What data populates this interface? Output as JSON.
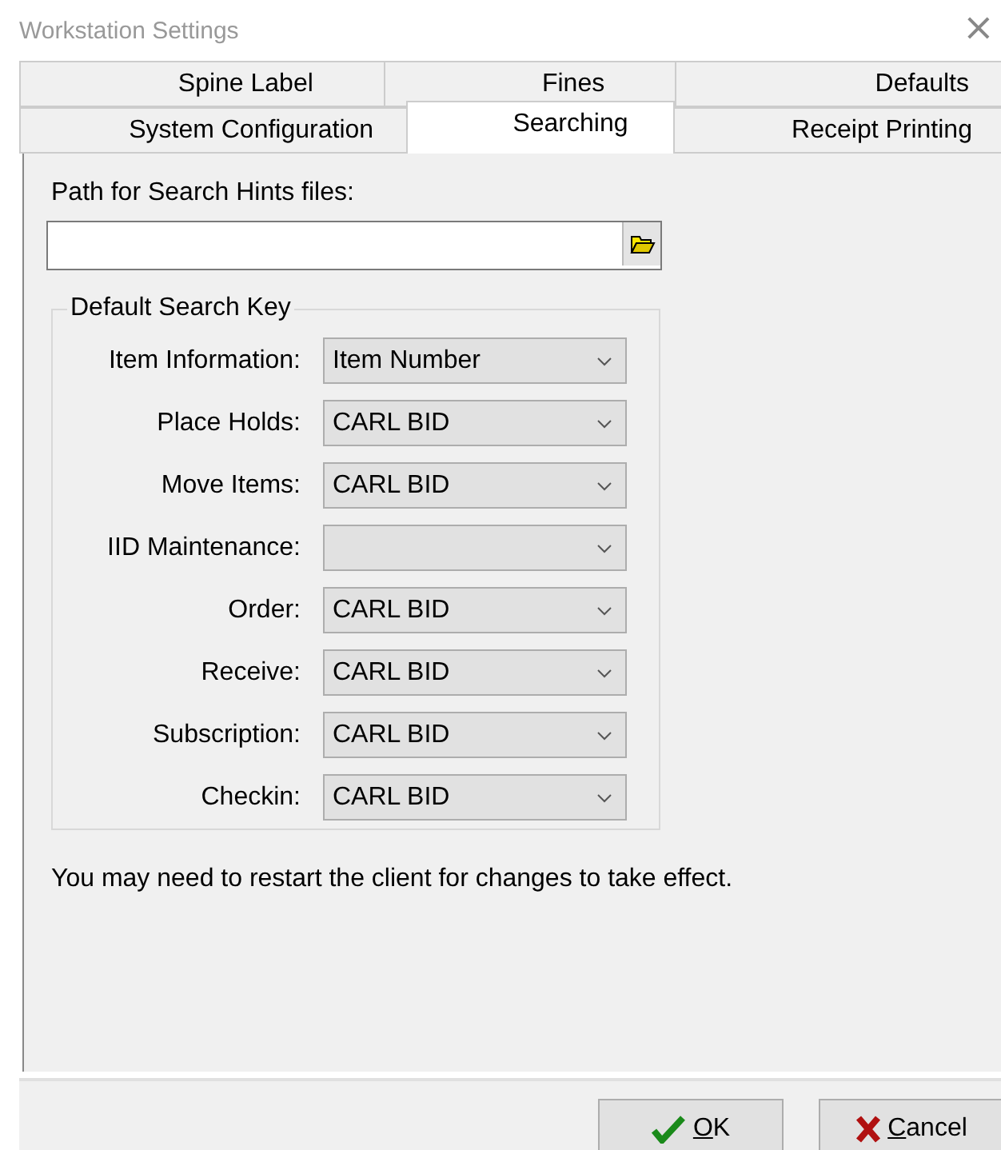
{
  "window": {
    "title": "Workstation Settings",
    "close": "×"
  },
  "tab_rows": [
    {
      "tabs": [
        {
          "label": "Spine Label",
          "selected": false
        },
        {
          "label": "Fines",
          "selected": false
        },
        {
          "label": "Defaults",
          "selected": false
        }
      ]
    },
    {
      "tabs": [
        {
          "label": "System Configuration",
          "selected": false
        },
        {
          "label": "Searching",
          "selected": true
        },
        {
          "label": "Receipt Printing",
          "selected": false
        }
      ]
    }
  ],
  "path_label": "Path for Search Hints files:",
  "group": {
    "title": "Default Search Key",
    "rows": [
      {
        "label": "Item Information:",
        "value": "Item Number"
      },
      {
        "label": "Place Holds:",
        "value": "CARL BID"
      },
      {
        "label": "Move Items:",
        "value": "CARL BID"
      },
      {
        "label": "IID Maintenance:"
      },
      {
        "label": "Order:",
        "value": "CARL BID"
      },
      {
        "label": "Receive:",
        "value": "CARL BID"
      },
      {
        "label": "Subscription:",
        "value": "CARL BID"
      },
      {
        "label": "Checkin:",
        "value": "CARL BID"
      }
    ]
  },
  "note": "You may need to restart the client for changes to take effect.",
  "buttons": [
    {
      "kind": "ok",
      "label": "OK"
    },
    {
      "kind": "cancel",
      "label": "Cancel"
    }
  ]
}
